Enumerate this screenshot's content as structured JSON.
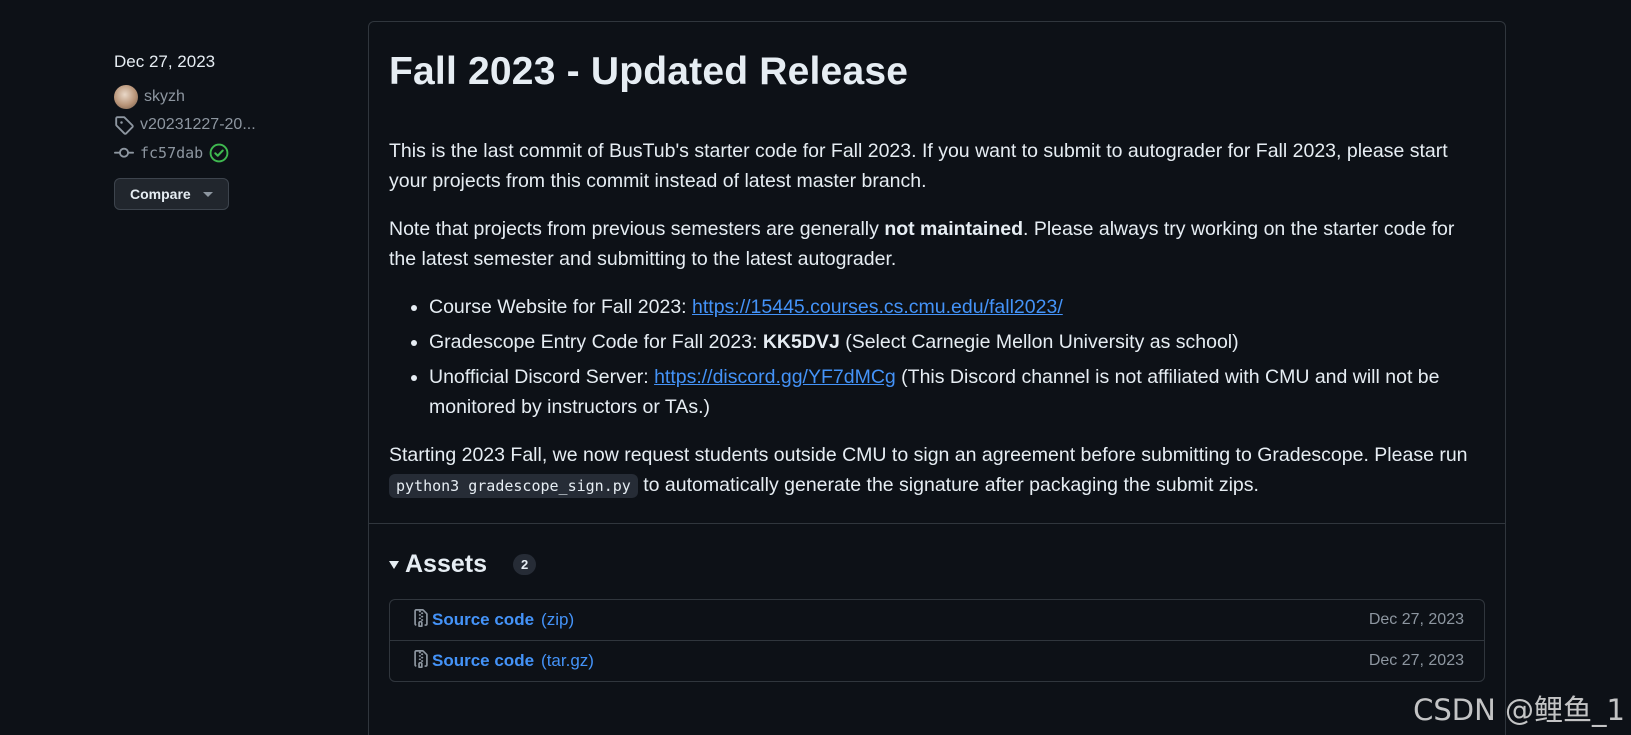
{
  "sidebar": {
    "date": "Dec 27, 2023",
    "author": "skyzh",
    "tag": "v20231227-20...",
    "commit": "fc57dab",
    "compare_label": "Compare"
  },
  "release": {
    "title": "Fall 2023 - Updated Release",
    "p1": "This is the last commit of BusTub's starter code for Fall 2023. If you want to submit to autograder for Fall 2023, please start your projects from this commit instead of latest master branch.",
    "p2_before": "Note that projects from previous semesters are generally ",
    "p2_bold": "not maintained",
    "p2_after": ". Please always try working on the starter code for the latest semester and submitting to the latest autograder.",
    "bullets": {
      "b1_prefix": "Course Website for Fall 2023: ",
      "b1_link": "https://15445.courses.cs.cmu.edu/fall2023/",
      "b2_prefix": "Gradescope Entry Code for Fall 2023: ",
      "b2_bold": "KK5DVJ",
      "b2_suffix": " (Select Carnegie Mellon University as school)",
      "b3_prefix": "Unofficial Discord Server: ",
      "b3_link": "https://discord.gg/YF7dMCg",
      "b3_suffix": " (This Discord channel is not affiliated with CMU and will not be monitored by instructors or TAs.)"
    },
    "p3_before": "Starting 2023 Fall, we now request students outside CMU to sign an agreement before submitting to Gradescope. Please run ",
    "p3_code": "python3 gradescope_sign.py",
    "p3_after": " to automatically generate the signature after packaging the submit zips."
  },
  "assets": {
    "title": "Assets",
    "count": "2",
    "items": [
      {
        "name": "Source code",
        "ext": "(zip)",
        "date": "Dec 27, 2023"
      },
      {
        "name": "Source code",
        "ext": "(tar.gz)",
        "date": "Dec 27, 2023"
      }
    ]
  },
  "watermark": "CSDN @鲤鱼_1",
  "colors": {
    "background": "#0d1117",
    "link": "#4493f8",
    "border": "#30363d",
    "muted": "#8d96a0",
    "verified": "#3fb950"
  }
}
